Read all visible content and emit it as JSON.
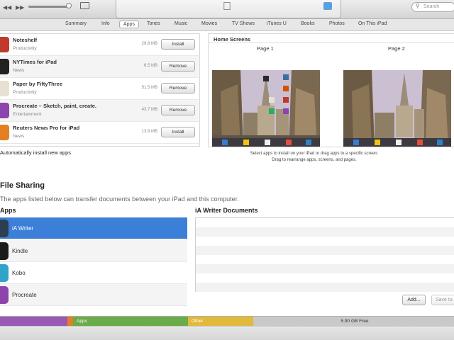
{
  "player": {
    "prev_icon": "rewind-icon",
    "next_icon": "fast-forward-icon",
    "volume_icon": "volume-slider",
    "airplay_icon": "airplay-icon",
    "apple_icon": "apple-logo-icon",
    "list_icon": "list-view-icon",
    "search_placeholder": "Search"
  },
  "tabs": [
    {
      "label": "Summary"
    },
    {
      "label": "Info"
    },
    {
      "label": "Apps",
      "active": true
    },
    {
      "label": "Tones"
    },
    {
      "label": "Music"
    },
    {
      "label": "Movies"
    },
    {
      "label": "TV Shows"
    },
    {
      "label": "iTunes U"
    },
    {
      "label": "Books"
    },
    {
      "label": "Photos"
    },
    {
      "label": "On This iPad"
    }
  ],
  "apps": [
    {
      "name": "Noteshelf",
      "category": "Productivity",
      "size": "29.8 MB",
      "action": "Install",
      "color": "#c0392b"
    },
    {
      "name": "NYTimes for iPad",
      "category": "News",
      "size": "6.5 MB",
      "action": "Remove",
      "color": "#222222"
    },
    {
      "name": "Paper by FiftyThree",
      "category": "Productivity",
      "size": "51.5 MB",
      "action": "Remove",
      "color": "#e8e0d0"
    },
    {
      "name": "Procreate – Sketch, paint, create.",
      "category": "Entertainment",
      "size": "43.7 MB",
      "action": "Remove",
      "color": "#8e44ad"
    },
    {
      "name": "Reuters News Pro for iPad",
      "category": "News",
      "size": "13.8 MB",
      "action": "Install",
      "color": "#e67e22"
    }
  ],
  "auto_install_label": "Automatically install new apps",
  "home_screens": {
    "title": "Home Screens",
    "page1": "Page 1",
    "page2": "Page 2",
    "hint_line1": "Select apps to install on your iPad or drag apps to a specific screen.",
    "hint_line2": "Drag to rearrange apps, screens, and pages."
  },
  "file_sharing": {
    "title": "File Sharing",
    "description": "The apps listed below can transfer documents between your iPad and this computer.",
    "apps_header": "Apps",
    "apps": [
      {
        "name": "iA Writer",
        "selected": true,
        "color": "#2c3e50"
      },
      {
        "name": "Kindle",
        "color": "#1a1a1a"
      },
      {
        "name": "Kobo",
        "color": "#2fa4c8"
      },
      {
        "name": "Procreate",
        "color": "#8e44ad"
      }
    ],
    "documents_title": "iA Writer Documents",
    "add_label": "Add...",
    "save_label": "Save to..."
  },
  "capacity": {
    "segments": [
      {
        "label": "",
        "color": "#9b59b6",
        "fraction": 0.148
      },
      {
        "label": "",
        "color": "#e67e22",
        "fraction": 0.013
      },
      {
        "label": "Apps",
        "color": "#6aab4a",
        "fraction": 0.253
      },
      {
        "label": "Other",
        "color": "#e2b93b",
        "fraction": 0.144
      },
      {
        "label": "",
        "color": "#c9c9c9",
        "fraction": 0.442
      }
    ],
    "free_label": "5.90 GB Free"
  }
}
